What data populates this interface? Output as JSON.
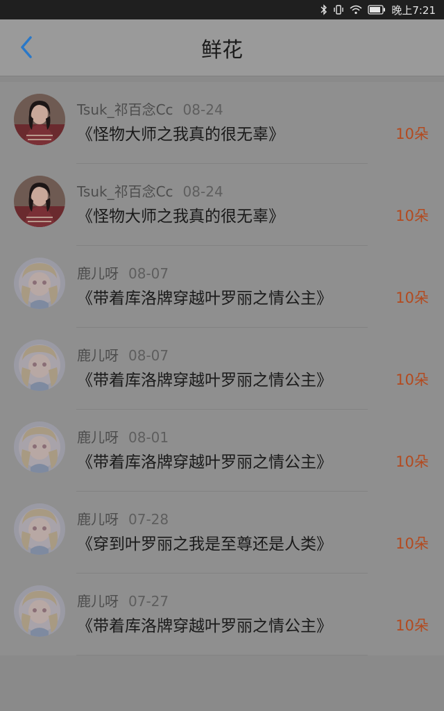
{
  "status_bar": {
    "time": "晚上7:21",
    "icons": [
      "bluetooth-icon",
      "vibrate-icon",
      "wifi-icon",
      "battery-icon"
    ]
  },
  "header": {
    "title": "鲜花",
    "back_icon": "chevron-left-icon"
  },
  "colors": {
    "accent": "#2a78c8",
    "count": "#b34a1f"
  },
  "items": [
    {
      "user": "Tsuk_祁百念Cc",
      "date": "08-24",
      "book": "《怪物大师之我真的很无辜》",
      "count": "10朵",
      "avatar": "girl-photo"
    },
    {
      "user": "Tsuk_祁百念Cc",
      "date": "08-24",
      "book": "《怪物大师之我真的很无辜》",
      "count": "10朵",
      "avatar": "girl-photo"
    },
    {
      "user": "鹿儿呀",
      "date": "08-07",
      "book": "《带着库洛牌穿越叶罗丽之情公主》",
      "count": "10朵",
      "avatar": "anime-illustration"
    },
    {
      "user": "鹿儿呀",
      "date": "08-07",
      "book": "《带着库洛牌穿越叶罗丽之情公主》",
      "count": "10朵",
      "avatar": "anime-illustration"
    },
    {
      "user": "鹿儿呀",
      "date": "08-01",
      "book": "《带着库洛牌穿越叶罗丽之情公主》",
      "count": "10朵",
      "avatar": "anime-illustration"
    },
    {
      "user": "鹿儿呀",
      "date": "07-28",
      "book": "《穿到叶罗丽之我是至尊还是人类》",
      "count": "10朵",
      "avatar": "anime-illustration"
    },
    {
      "user": "鹿儿呀",
      "date": "07-27",
      "book": "《带着库洛牌穿越叶罗丽之情公主》",
      "count": "10朵",
      "avatar": "anime-illustration"
    }
  ]
}
